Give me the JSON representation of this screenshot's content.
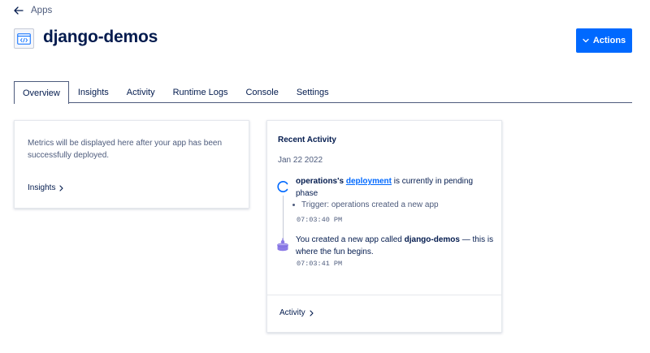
{
  "breadcrumb": {
    "label": "Apps"
  },
  "header": {
    "title": "django-demos",
    "actions_label": "Actions"
  },
  "tabs": [
    {
      "label": "Overview",
      "active": true
    },
    {
      "label": "Insights"
    },
    {
      "label": "Activity"
    },
    {
      "label": "Runtime Logs"
    },
    {
      "label": "Console"
    },
    {
      "label": "Settings"
    }
  ],
  "metrics_card": {
    "message": "Metrics will be displayed here after your app has been successfully deployed.",
    "link_label": "Insights"
  },
  "activity_card": {
    "title": "Recent Activity",
    "date": "Jan 22 2022",
    "events": [
      {
        "actor": "operations's",
        "link_text": "deployment",
        "rest": " is currently in pending phase",
        "trigger": "Trigger: operations created a new app",
        "time": "07:03:40 PM"
      },
      {
        "prefix": "You created a new app called ",
        "app_name": "django-demos",
        "suffix": " — this is where the fun begins.",
        "time": "07:03:41 PM"
      }
    ],
    "link_label": "Activity"
  },
  "colors": {
    "primary": "#0069ff",
    "text": "#031b4e",
    "muted": "#4d5b7c",
    "accent_purple": "#8c7be6"
  }
}
